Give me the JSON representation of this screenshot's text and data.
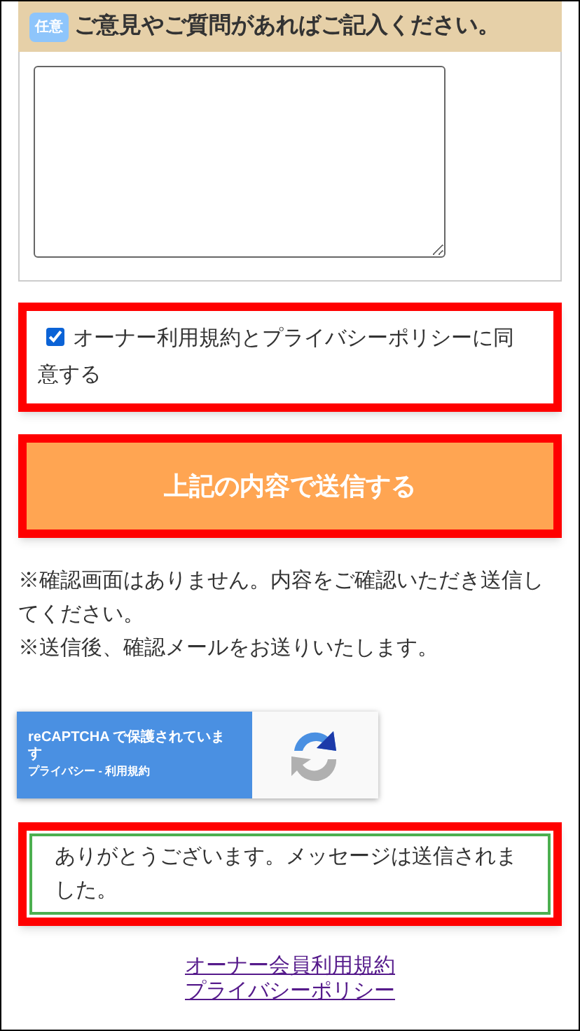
{
  "question": {
    "badge": "任意",
    "label": "ご意見やご質問があればご記入ください。"
  },
  "agreement": {
    "label": "オーナー利用規約とプライバシーポリシーに同意する",
    "checked": true
  },
  "submit_button": "上記の内容で送信する",
  "notes": [
    "※確認画面はありません。内容をご確認いただき送信してください。",
    "※送信後、確認メールをお送りいたします。"
  ],
  "recaptcha": {
    "title": "reCAPTCHA で保護されています",
    "links": "プライバシー - 利用規約"
  },
  "success_message": "ありがとうございます。メッセージは送信されました。",
  "footer_links": [
    "オーナー会員利用規約",
    "プライバシーポリシー"
  ]
}
